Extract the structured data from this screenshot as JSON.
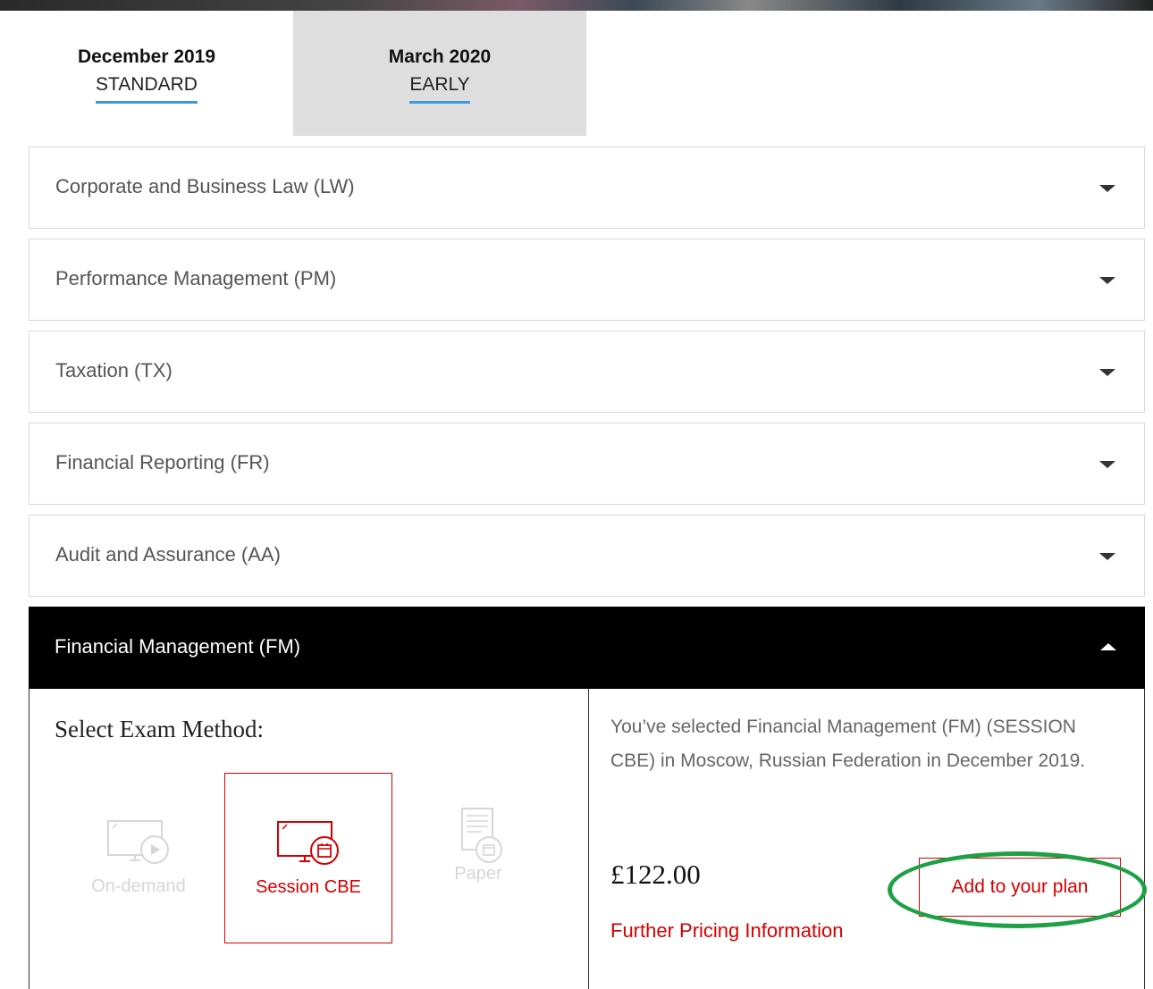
{
  "tabs": [
    {
      "date": "December 2019",
      "type": "STANDARD",
      "active": true
    },
    {
      "date": "March 2020",
      "type": "EARLY",
      "active": false
    }
  ],
  "papers": [
    {
      "label": "Corporate and Business Law (LW)"
    },
    {
      "label": "Performance Management (PM)"
    },
    {
      "label": "Taxation (TX)"
    },
    {
      "label": "Financial Reporting (FR)"
    },
    {
      "label": "Audit and Assurance (AA)"
    }
  ],
  "open_paper": {
    "label": "Financial Management (FM)",
    "select_title": "Select Exam Method:",
    "methods": [
      {
        "label": "On-demand",
        "icon": "on-demand-monitor-play-icon",
        "enabled": false,
        "selected": false
      },
      {
        "label": "Session CBE",
        "icon": "session-cbe-monitor-calendar-icon",
        "enabled": true,
        "selected": true
      },
      {
        "label": "Paper",
        "icon": "paper-document-calendar-icon",
        "enabled": false,
        "selected": false
      }
    ],
    "summary": "You’ve selected Financial Management (FM) (SESSION CBE) in Moscow, Russian Federation in December 2019.",
    "price": "£122.00",
    "pricing_link": "Further Pricing Information",
    "add_button": "Add to your plan"
  },
  "colors": {
    "accent_red": "#d40000",
    "tab_underline_blue": "#3b9ad9",
    "highlight_green": "#1ea046",
    "inactive_tab_grey": "#dedede"
  }
}
